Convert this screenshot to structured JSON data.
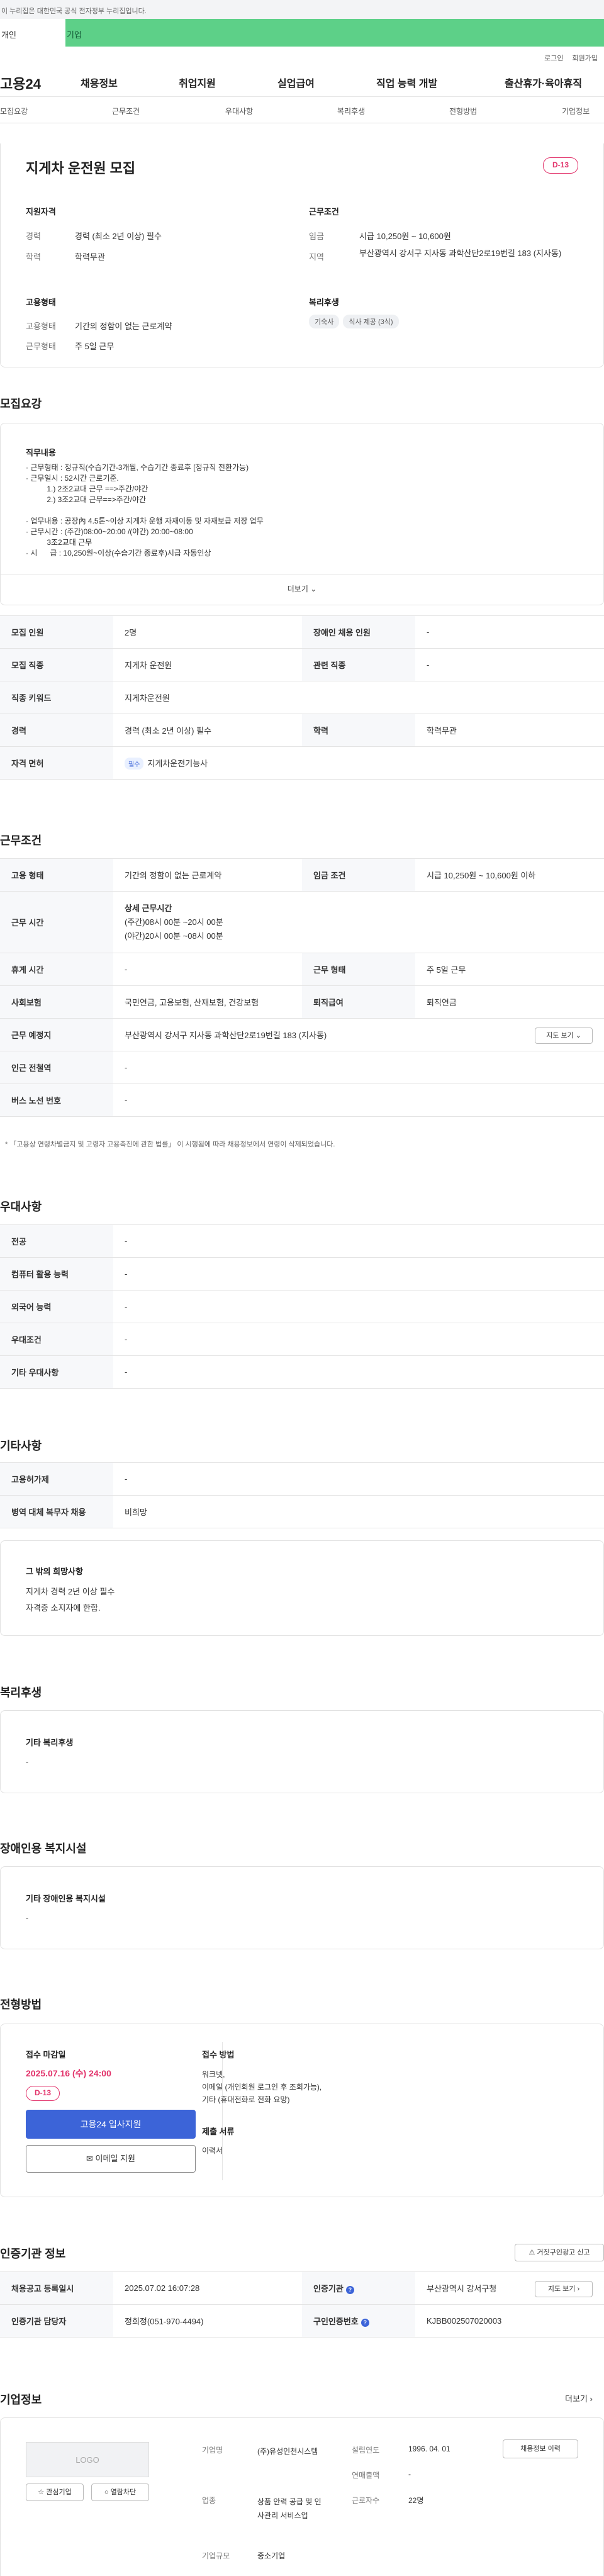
{
  "gov_notice": "이 누리집은 대한민국 공식 전자정부 누리집입니다.",
  "user_tabs": [
    "개인",
    "기업"
  ],
  "util_links": [
    "로그인",
    "회원가입"
  ],
  "brand": "고용24",
  "gnb": [
    "채용정보",
    "취업지원",
    "실업급여",
    "직업 능력 개발",
    "출산휴가·육아휴직"
  ],
  "anchor_tabs": [
    "모집요강",
    "근무조건",
    "우대사항",
    "복리후생",
    "전형방법",
    "기업정보"
  ],
  "title": "지게차 운전원 모집",
  "dday": "D-13",
  "summary": {
    "req_title": "지원자격",
    "cond_title": "근무조건",
    "emp_title": "고용형태",
    "welfare_title": "복리후생",
    "career_l": "경력",
    "career_v": "경력 (최소 2년 이상) 필수",
    "edu_l": "학력",
    "edu_v": "학력무관",
    "wage_l": "임금",
    "wage_v": "시급 10,250원 ~ 10,600원",
    "area_l": "지역",
    "area_v": "부산광역시 강서구 지사동 과학산단2로19번길 183 (지사동)",
    "emptype_l": "고용형태",
    "emptype_v": "기간의 정함이 없는 근로계약",
    "worktype_l": "근무형태",
    "worktype_v": "주 5일 근무",
    "chips": [
      "기숙사",
      "식사 제공 (3식)"
    ]
  },
  "recruit": {
    "section": "모집요강",
    "duty_title": "직무내용",
    "duty_text": "· 근무형태 : 정규직(수습기간-3개월, 수습기간 종료후 [정규직 전환가능)\n· 근무일시 : 52시간 근로기준.\n          1.) 2조2교대 근무 ==>주간/야간\n          2.) 3조2교대 근무==>주간/야간\n\n· 업무내용 : 공장內 4.5톤~이상 지게차 운행 자재이동 및 자재보급 저장 업무\n· 근무시간 : (주간)08:00~20:00 /(야간) 20:00~08:00\n          3조2교대 근무\n· 시      급 : 10,250원~이상(수습기간 종료후)시급 자동인상",
    "more": "더보기",
    "rows": [
      {
        "h1": "모집 인원",
        "v1": "2명",
        "h2": "장애인 채용 인원",
        "v2": "-"
      },
      {
        "h1": "모집 직종",
        "v1": "지게차 운전원",
        "h2": "관련 직종",
        "v2": "-"
      },
      {
        "h1": "직종 키워드",
        "v1": "지게차운전원"
      },
      {
        "h1": "경력",
        "v1": "경력 (최소 2년 이상) 필수",
        "h2": "학력",
        "v2": "학력무관"
      },
      {
        "h1": "자격 면허",
        "badge": "필수",
        "v1": "지게차운전기능사"
      }
    ]
  },
  "work": {
    "section": "근무조건",
    "emp_h": "고용 형태",
    "emp_v": "기간의 정함이 없는 근로계약",
    "wage_h": "임금 조건",
    "wage_v": "시급 10,250원 ~ 10,600원 이하",
    "time_h": "근무 시간",
    "time_title": "상세 근무시간",
    "time_1": "(주간)08시 00분 ~20시 00분",
    "time_2": "(야간)20시 00분 ~08시 00분",
    "rest_h": "휴게 시간",
    "rest_v": "-",
    "form_h": "근무 형태",
    "form_v": "주 5일 근무",
    "ins_h": "사회보험",
    "ins_v": "국민연금, 고용보험, 산재보험, 건강보험",
    "ret_h": "퇴직급여",
    "ret_v": "퇴직연금",
    "place_h": "근무 예정지",
    "place_v": "부산광역시 강서구 지사동 과학산단2로19번길 183 (지사동)",
    "map_btn": "지도 보기",
    "sub_h": "인근 전철역",
    "sub_v": "-",
    "bus_h": "버스 노선 번호",
    "bus_v": "-",
    "note": "* 「고용상 연령차별금지 및 고령자 고용촉진에 관한 법률」 이 시행됨에 따라 채용정보에서 연령이 삭제되었습니다."
  },
  "pref": {
    "section": "우대사항",
    "rows": [
      [
        "전공",
        "-"
      ],
      [
        "컴퓨터 활용 능력",
        "-"
      ],
      [
        "외국어 능력",
        "-"
      ],
      [
        "우대조건",
        "-"
      ],
      [
        "기타 우대사항",
        "-"
      ]
    ]
  },
  "etc": {
    "section": "기타사항",
    "rows": [
      [
        "고용허가제",
        "-"
      ],
      [
        "병역 대체 복무자 채용",
        "비희망"
      ]
    ],
    "box_title": "그 밖의 희망사항",
    "box_l1": "지게차 경력 2년 이상 필수",
    "box_l2": "자격증 소지자에 한함."
  },
  "welfare": {
    "section": "복리후생",
    "label": "기타 복리후생",
    "value": "-"
  },
  "disab": {
    "section": "장애인용 복지시설",
    "label": "기타 장애인용 복지시설",
    "value": "-"
  },
  "select": {
    "section": "전형방법",
    "deadline_l": "접수 마감일",
    "deadline_v": "2025.07.16 (수) 24:00",
    "dday": "D-13",
    "apply_btn": "고용24 입사지원",
    "email_btn": "이메일 지원",
    "method_l": "접수 방법",
    "method_1": "워크넷,",
    "method_2": "이메일 (개인회원 로그인 후 조회가능),",
    "method_3": "기타 (휴대전화로 전화 요망)",
    "docs_l": "제출 서류",
    "docs_v": "이력서"
  },
  "agency": {
    "section": "인증기관 정보",
    "report_btn": "거짓구인광고 신고",
    "reg_h": "채용공고 등록일시",
    "reg_v": "2025.07.02 16:07:28",
    "org_h": "인증기관",
    "org_v": "부산광역시 강서구청",
    "map_btn": "지도 보기",
    "mgr_h": "인증기관 담당자",
    "mgr_v": "정희정(051-970-4494)",
    "no_h": "구인인증번호",
    "no_v": "KJBB002507020003"
  },
  "company": {
    "section": "기업정보",
    "more": "더보기",
    "logo": "LOGO",
    "fav_btn": "관심기업",
    "block_btn": "열람차단",
    "name_l": "기업명",
    "name_v": "(주)유성인천시스템",
    "ind_l": "업종",
    "ind_v": "상품 안력 공급 및 인사관리 서비스업",
    "size_l": "기업규모",
    "size_v": "중소기업",
    "est_l": "설립연도",
    "est_v": "1996. 04. 01",
    "sales_l": "연매출액",
    "sales_v": "-",
    "emp_l": "근로자수",
    "emp_v": "22명",
    "jobs_btn": "채용정보 이력"
  }
}
